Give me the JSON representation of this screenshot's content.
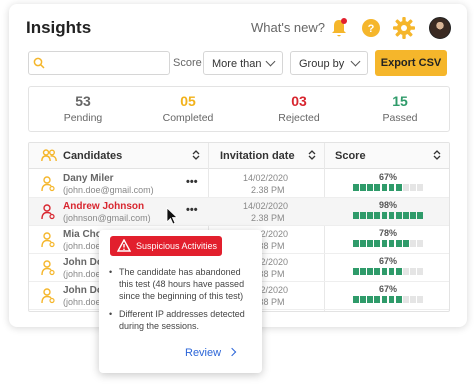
{
  "header": {
    "title": "Insights",
    "whats_new": "What's new?"
  },
  "icons": {
    "bell": "bell-icon",
    "help": "help-icon",
    "settings": "gear-icon",
    "search": "search-icon",
    "user": "user-icon",
    "warning": "warning-icon",
    "sort": "sort-icon"
  },
  "colors": {
    "accent": "#f5b62b",
    "success": "#2f9b6a",
    "danger": "#e21f2d",
    "link": "#2b65d8"
  },
  "toolbar": {
    "search_value": "",
    "score_label": "Score",
    "score_filter": "More than",
    "group_by": "Group by",
    "export": "Export CSV"
  },
  "stats": [
    {
      "value": "53",
      "label": "Pending",
      "color": "#666666"
    },
    {
      "value": "05",
      "label": "Completed",
      "color": "#f2b21b"
    },
    {
      "value": "03",
      "label": "Rejected",
      "color": "#d8262f"
    },
    {
      "value": "15",
      "label": "Passed",
      "color": "#2f9b6a"
    }
  ],
  "table": {
    "headers": [
      "Candidates",
      "Invitation date",
      "Score"
    ],
    "rows": [
      {
        "name": "Dany Miler",
        "email": "(john.doe@gmail.com)",
        "date": "14/02/2020",
        "time": "2.38 PM",
        "score": "67%"
      },
      {
        "name": "Andrew Johnson",
        "email": "(johnson@gmail.com)",
        "date": "14/02/2020",
        "time": "2.38 PM",
        "score": "98%"
      },
      {
        "name": "Mia Cho",
        "email": "(john.doe@gmail.com)",
        "date": "14/02/2020",
        "time": "2.38 PM",
        "score": "78%"
      },
      {
        "name": "John Doe",
        "email": "(john.doe@gmail.com)",
        "date": "14/02/2020",
        "time": "2.38 PM",
        "score": "67%"
      },
      {
        "name": "John Doe",
        "email": "(john.doe@gmail.com)",
        "date": "14/02/2020",
        "time": "2.38 PM",
        "score": "67%"
      }
    ]
  },
  "tooltip": {
    "badge": "Suspicious Activities",
    "items": [
      "The candidate has abandoned this test (48 hours have passed since the beginning of this test)",
      "Different IP addresses detected during the sessions."
    ],
    "review": "Review"
  }
}
